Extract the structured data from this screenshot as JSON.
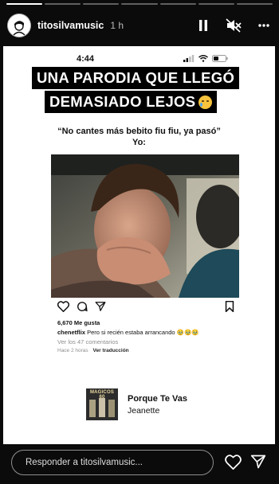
{
  "story": {
    "progress": [
      1,
      0,
      0,
      0,
      0,
      0,
      0
    ],
    "username": "titosilvamusic",
    "time": "1 h"
  },
  "post": {
    "status_time": "4:44",
    "banner_line1": "UNA PARODIA QUE LLEGÓ",
    "banner_line2": "DEMASIADO LEJOS",
    "quote_line1": "“No cantes más bebito fiu fiu, ya pasó”",
    "quote_line2": "Yo:",
    "likes": "6,670 Me gusta",
    "caption_user": "chenetflix",
    "caption_text": "Pero si recién estaba arrancando 🥹🥹🥹",
    "comments": "Ver los 47 comentarios",
    "posted": "Hace 2 horas",
    "translate": "Ver traducción"
  },
  "music": {
    "album_text": "MAGICOS 60",
    "title": "Porque Te Vas",
    "artist": "Jeanette"
  },
  "footer": {
    "reply_placeholder": "Responder a titosilvamusic..."
  },
  "colors": {
    "background": "#0b0b0b",
    "card": "#ffffff",
    "banner": "#000000"
  }
}
